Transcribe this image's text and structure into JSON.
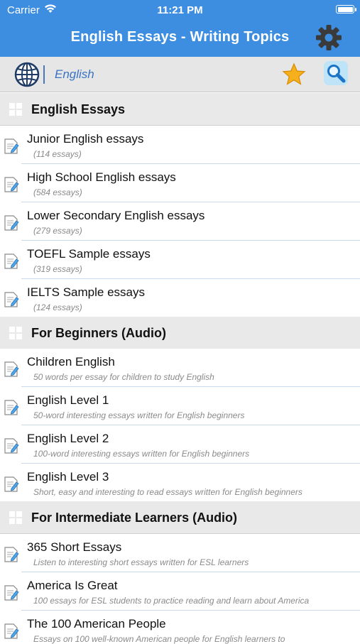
{
  "status": {
    "carrier": "Carrier",
    "time": "11:21 PM"
  },
  "nav": {
    "title": "English Essays - Writing Topics"
  },
  "language": {
    "label": "English"
  },
  "sections": [
    {
      "title": "English Essays",
      "items": [
        {
          "title": "Junior English essays",
          "subtitle": "(114 essays)"
        },
        {
          "title": "High School English essays",
          "subtitle": "(584 essays)"
        },
        {
          "title": "Lower Secondary English essays",
          "subtitle": "(279 essays)"
        },
        {
          "title": "TOEFL Sample essays",
          "subtitle": "(319 essays)"
        },
        {
          "title": "IELTS Sample essays",
          "subtitle": "(124 essays)"
        }
      ]
    },
    {
      "title": "For Beginners (Audio)",
      "items": [
        {
          "title": "Children English",
          "subtitle": "50 words per essay for children to study English"
        },
        {
          "title": "English Level 1",
          "subtitle": "50-word interesting essays written for English beginners"
        },
        {
          "title": "English Level 2",
          "subtitle": "100-word interesting essays written for English beginners"
        },
        {
          "title": "English Level 3",
          "subtitle": "Short, easy and interesting to read essays written for English beginners"
        }
      ]
    },
    {
      "title": "For Intermediate Learners (Audio)",
      "items": [
        {
          "title": "365 Short Essays",
          "subtitle": "Listen to interesting short essays written for ESL learners"
        },
        {
          "title": "America Is Great",
          "subtitle": "100 essays for ESL students to practice reading and learn about America"
        },
        {
          "title": "The 100 American People",
          "subtitle": "Essays on 100 well-known American people for English learners to"
        }
      ]
    }
  ],
  "colors": {
    "nav": "#3d8ee0",
    "section_bg": "#e9e9e9",
    "accent_text": "#3a73c4"
  }
}
